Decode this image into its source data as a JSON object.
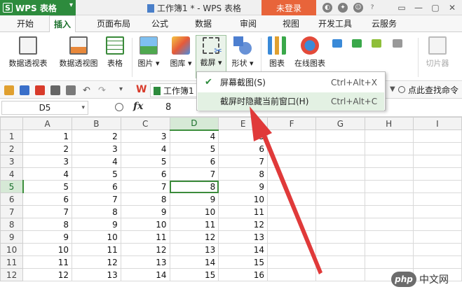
{
  "titlebar": {
    "app_name": "WPS 表格",
    "app_logo": "S",
    "doc_title": "工作簿1 * - WPS 表格",
    "login_label": "未登录"
  },
  "menu": {
    "tabs": [
      "开始",
      "插入",
      "页面布局",
      "公式",
      "数据",
      "审阅",
      "视图",
      "开发工具",
      "云服务"
    ],
    "active": "插入"
  },
  "ribbon": {
    "pivot_table": "数据透视表",
    "pivot_chart": "数据透视图",
    "table": "表格",
    "picture": "图片",
    "gallery": "图库",
    "screenshot": "截屏",
    "shapes": "形状",
    "chart": "图表",
    "online_chart": "在线图表",
    "slicer": "切片器"
  },
  "quickbar": {
    "doc_tab": "工作簿1",
    "search_label": "点此查找命令"
  },
  "formula": {
    "cell_ref": "D5",
    "fx": "fx",
    "value": "8"
  },
  "dropdown": {
    "items": [
      {
        "label": "屏幕截图(S)",
        "shortcut": "Ctrl+Alt+X",
        "checked": true
      },
      {
        "label": "截屏时隐藏当前窗口(H)",
        "shortcut": "Ctrl+Alt+C",
        "checked": false
      }
    ]
  },
  "grid": {
    "columns": [
      "A",
      "B",
      "C",
      "D",
      "E",
      "F",
      "G",
      "H",
      "I"
    ],
    "selected_column": "D",
    "selected_row": 5,
    "rows": [
      [
        1,
        2,
        3,
        4,
        5
      ],
      [
        2,
        3,
        4,
        5,
        6
      ],
      [
        3,
        4,
        5,
        6,
        7
      ],
      [
        4,
        5,
        6,
        7,
        8
      ],
      [
        5,
        6,
        7,
        8,
        9
      ],
      [
        6,
        7,
        8,
        9,
        10
      ],
      [
        7,
        8,
        9,
        10,
        11
      ],
      [
        8,
        9,
        10,
        11,
        12
      ],
      [
        9,
        10,
        11,
        12,
        13
      ],
      [
        10,
        11,
        12,
        13,
        14
      ],
      [
        11,
        12,
        13,
        14,
        15
      ],
      [
        12,
        13,
        14,
        15,
        16
      ]
    ]
  },
  "watermark": {
    "logo": "php",
    "text": "中文网"
  },
  "colors": {
    "brand_green": "#2d8b3d",
    "login_orange": "#e8643a",
    "arrow_red": "#e03a3a"
  }
}
